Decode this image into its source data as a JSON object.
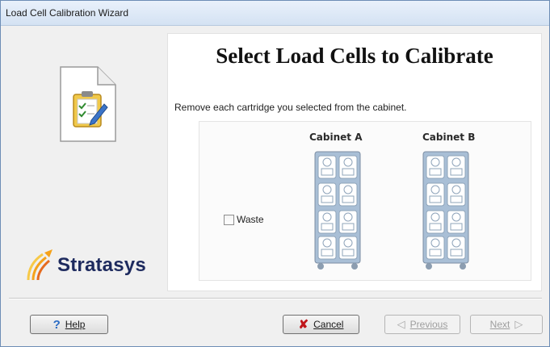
{
  "window": {
    "title": "Load Cell Calibration Wizard"
  },
  "branding": {
    "logo_text": "Stratasys",
    "logo_colors": [
      "#f5a21b",
      "#e56b1f",
      "#f7c948"
    ],
    "wordmark_color": "#1d2a5e"
  },
  "main": {
    "heading": "Select Load Cells to Calibrate",
    "instruction": "Remove each cartridge you selected from the cabinet.",
    "cabinets": [
      {
        "label": "Cabinet A",
        "slots": 8
      },
      {
        "label": "Cabinet B",
        "slots": 8
      }
    ],
    "waste": {
      "label": "Waste",
      "checked": false
    }
  },
  "buttons": {
    "help": "Help",
    "cancel": "Cancel",
    "previous": "Previous",
    "next": "Next"
  },
  "icons": {
    "doc": "clipboard-document-icon",
    "help": "question-mark-icon",
    "cancel": "red-x-icon",
    "previous": "left-arrow-icon",
    "next": "right-arrow-icon"
  }
}
